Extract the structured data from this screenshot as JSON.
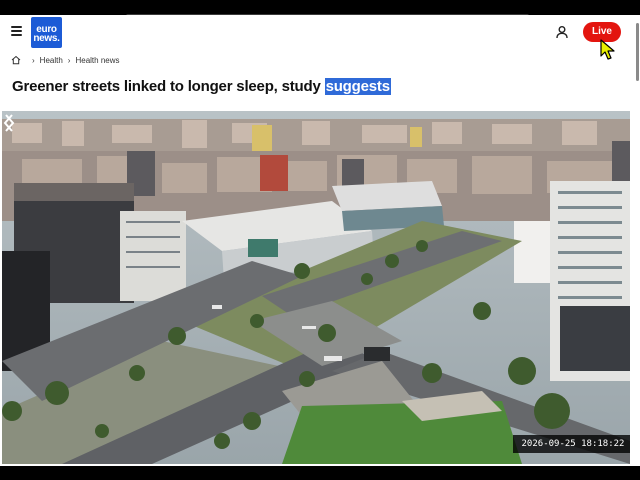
{
  "header": {
    "logo_line1": "euro",
    "logo_line2": "news.",
    "live_label": "Live"
  },
  "breadcrumb": {
    "items": [
      "Health",
      "Health news"
    ]
  },
  "article": {
    "title_main": "Greener streets linked to longer sleep, study ",
    "title_highlight": "suggests"
  },
  "hero": {
    "timestamp": "2026-09-25  18:18:22"
  },
  "icons": {
    "menu": "hamburger-menu-icon",
    "user": "user-icon",
    "home": "home-icon",
    "prev": "chevron-left-icon",
    "next": "chevron-right-icon",
    "cursor": "mouse-pointer-icon"
  },
  "colors": {
    "brand": "#1c5bd6",
    "live": "#e3150f",
    "highlight": "#2f6ad8",
    "cursor": "#e8f000"
  }
}
